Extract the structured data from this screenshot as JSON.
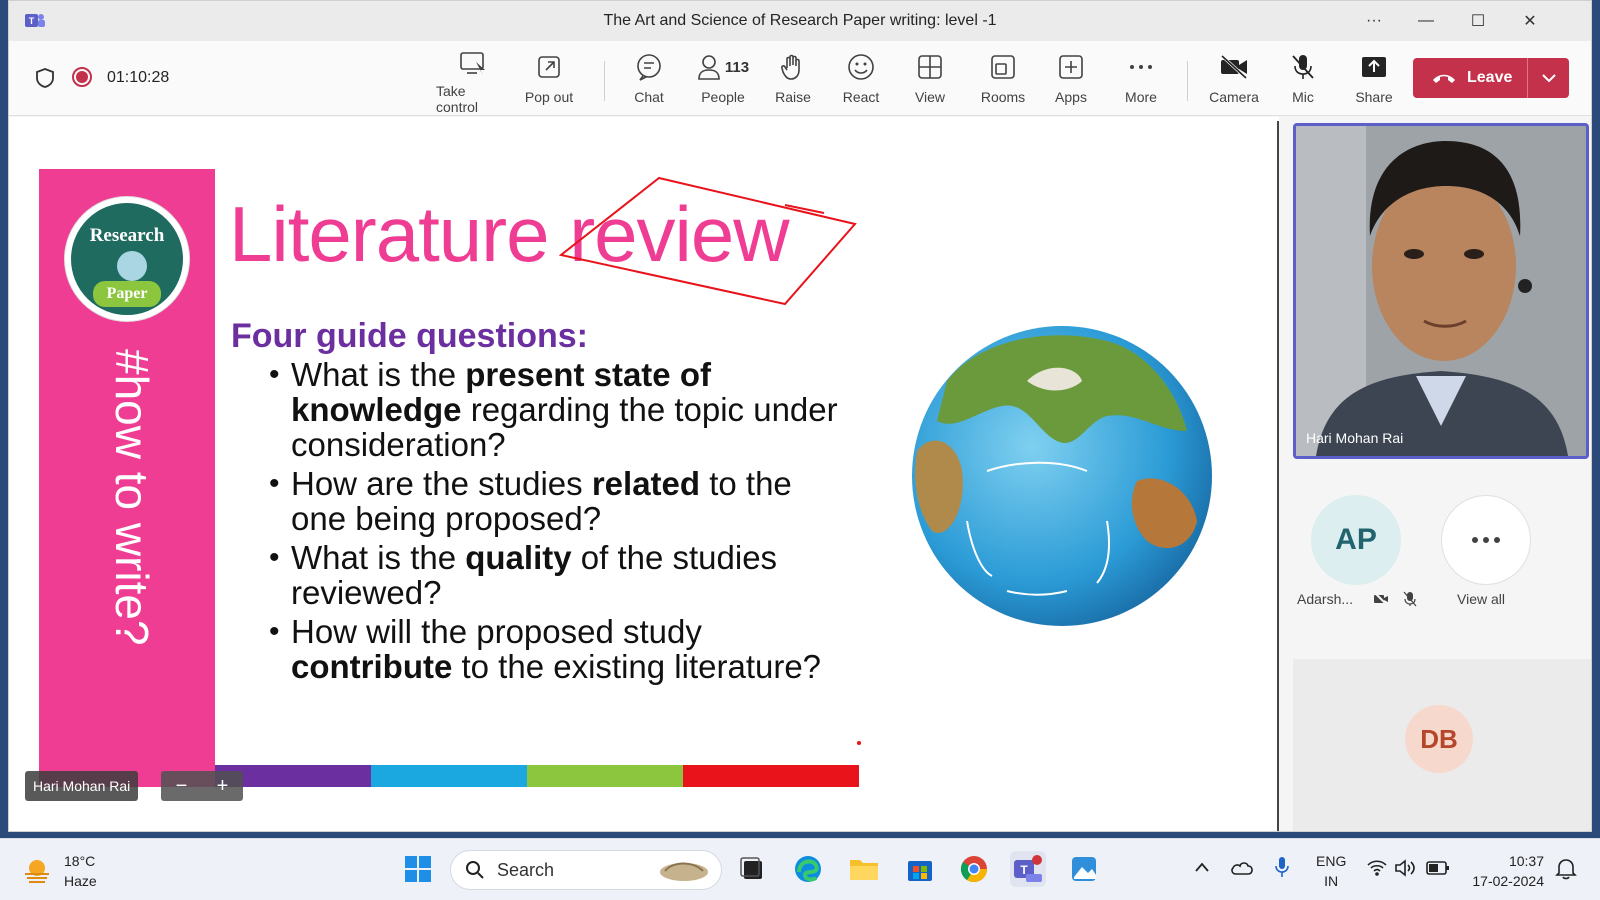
{
  "window": {
    "title": "The Art and Science of Research Paper writing: level -1"
  },
  "toolbar": {
    "timer": "01:10:28",
    "buttons": [
      {
        "label": "Take control",
        "icon": "take-control-icon"
      },
      {
        "label": "Pop out",
        "icon": "pop-out-icon"
      },
      {
        "label": "Chat",
        "icon": "chat-icon"
      },
      {
        "label": "People",
        "icon": "people-icon",
        "count": "113"
      },
      {
        "label": "Raise",
        "icon": "raise-hand-icon"
      },
      {
        "label": "React",
        "icon": "react-icon"
      },
      {
        "label": "View",
        "icon": "view-icon"
      },
      {
        "label": "Rooms",
        "icon": "rooms-icon"
      },
      {
        "label": "Apps",
        "icon": "apps-icon"
      },
      {
        "label": "More",
        "icon": "more-icon"
      },
      {
        "label": "Camera",
        "icon": "camera-off-icon"
      },
      {
        "label": "Mic",
        "icon": "mic-off-icon"
      },
      {
        "label": "Share",
        "icon": "share-icon"
      }
    ],
    "leave_label": "Leave",
    "leave_color": "#c4314b"
  },
  "slide": {
    "logo_top": "Research",
    "logo_bottom": "Paper",
    "hashtag": "#how to write?",
    "title": "Literature review",
    "subtitle": "Four guide questions:",
    "questions": [
      {
        "pre": "What is the ",
        "bold": "present state of knowledge",
        "post": " regarding the topic under consideration?"
      },
      {
        "pre": "How are the studies ",
        "bold": "related",
        "post": " to the one being proposed?"
      },
      {
        "pre": "What is the ",
        "bold": "quality",
        "post": " of the studies reviewed?"
      },
      {
        "pre": "How will the proposed study ",
        "bold": "contribute",
        "post": " to the existing literature?"
      }
    ],
    "accent_pink": "#ee3d93",
    "accent_purple": "#6b2fa0",
    "bar_colors": [
      "#ee3d93",
      "#6b2fa0",
      "#1ba7e0",
      "#8cc63f",
      "#e8131b"
    ]
  },
  "stage": {
    "presenter_name": "Hari Mohan Rai"
  },
  "participants": {
    "main_video_name": "Hari Mohan Rai",
    "ap_initials": "AP",
    "ap_name": "Adarsh...",
    "view_all_label": "View all",
    "db_initials": "DB"
  },
  "taskbar": {
    "temperature": "18°C",
    "weather": "Haze",
    "search_placeholder": "Search",
    "lang_top": "ENG",
    "lang_bottom": "IN",
    "time": "10:37",
    "date": "17-02-2024"
  }
}
